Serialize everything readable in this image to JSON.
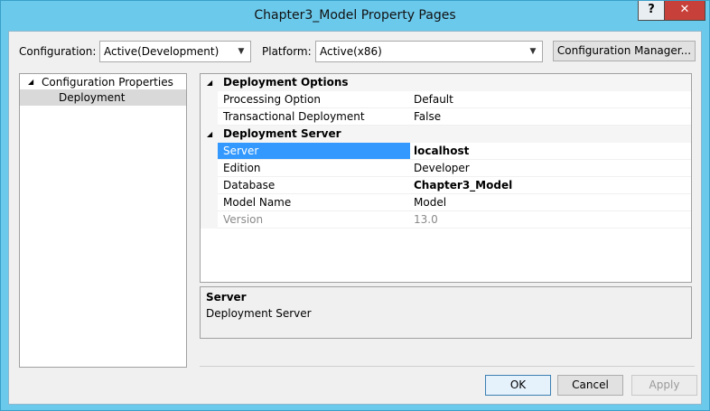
{
  "window": {
    "title": "Chapter3_Model Property Pages",
    "help_label": "?",
    "close_label": "✕"
  },
  "toolbar": {
    "configuration_label": "Configuration:",
    "configuration_value": "Active(Development)",
    "platform_label": "Platform:",
    "platform_value": "Active(x86)",
    "config_manager_label": "Configuration Manager..."
  },
  "tree": {
    "root": {
      "label": "Configuration Properties",
      "expander": "◢"
    },
    "child": {
      "label": "Deployment"
    }
  },
  "grid": {
    "expander": "◢",
    "categories": [
      {
        "name": "Deployment Options",
        "rows": [
          {
            "name": "Processing Option",
            "value": "Default"
          },
          {
            "name": "Transactional Deployment",
            "value": "False"
          }
        ]
      },
      {
        "name": "Deployment Server",
        "rows": [
          {
            "name": "Server",
            "value": "localhost"
          },
          {
            "name": "Edition",
            "value": "Developer"
          },
          {
            "name": "Database",
            "value": "Chapter3_Model"
          },
          {
            "name": "Model Name",
            "value": "Model"
          },
          {
            "name": "Version",
            "value": "13.0"
          }
        ]
      }
    ]
  },
  "description": {
    "title": "Server",
    "text": "Deployment Server"
  },
  "buttons": {
    "ok": "OK",
    "cancel": "Cancel",
    "apply": "Apply"
  },
  "colors": {
    "titlebar": "#6bc9ec",
    "selection": "#3399ff",
    "close": "#c8403a"
  }
}
